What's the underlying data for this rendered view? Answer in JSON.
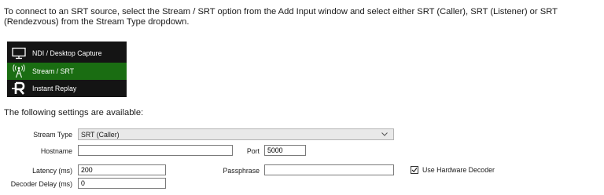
{
  "intro": {
    "text": "To connect to an SRT source, select the Stream / SRT option from the Add Input window and select either SRT (Caller), SRT (Listener) or SRT (Rendezvous) from the Stream Type dropdown."
  },
  "menu": {
    "items": [
      {
        "label": "NDI / Desktop Capture",
        "icon": "monitor-icon",
        "selected": false
      },
      {
        "label": "Stream / SRT",
        "icon": "broadcast-tower-icon",
        "selected": true
      },
      {
        "label": "Instant Replay",
        "icon": "replay-r-icon",
        "selected": false
      }
    ],
    "colors": {
      "background": "#141414",
      "selected": "#1a6d12"
    }
  },
  "settings": {
    "heading": "The following settings are available:",
    "stream_type": {
      "label": "Stream Type",
      "value": "SRT (Caller)"
    },
    "hostname": {
      "label": "Hostname",
      "value": ""
    },
    "port": {
      "label": "Port",
      "value": "5000"
    },
    "latency": {
      "label": "Latency (ms)",
      "value": "200"
    },
    "passphrase": {
      "label": "Passphrase",
      "value": ""
    },
    "decoder_delay": {
      "label": "Decoder Delay (ms)",
      "value": "0"
    },
    "hardware_decoder": {
      "label": "Use Hardware Decoder",
      "checked": true
    }
  }
}
